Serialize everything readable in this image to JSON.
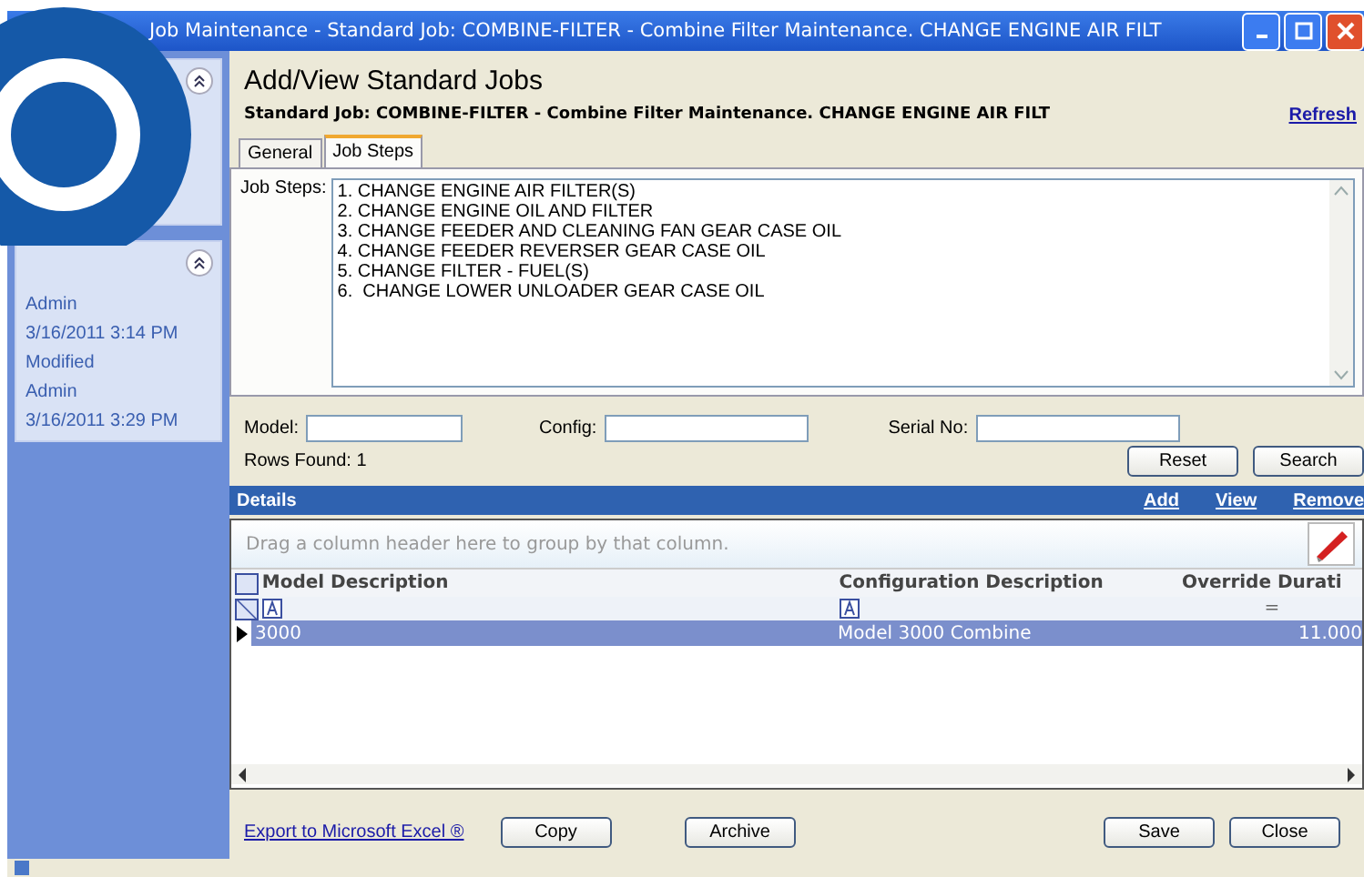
{
  "window": {
    "title": "Job Maintenance - Standard Job: COMBINE-FILTER - Combine Filter Maintenance. CHANGE ENGINE AIR FILT"
  },
  "sidebar": {
    "items": [
      {
        "text": "Admin"
      },
      {
        "text": "3/16/2011 3:14 PM"
      },
      {
        "text": "Modified"
      },
      {
        "text": "Admin"
      },
      {
        "text": "3/16/2011 3:29 PM"
      }
    ]
  },
  "header": {
    "title": "Add/View Standard Jobs",
    "subtitle": "Standard Job: COMBINE-FILTER - Combine Filter Maintenance. CHANGE ENGINE AIR FILT",
    "refresh": "Refresh"
  },
  "tabs": [
    {
      "label": "General",
      "selected": false
    },
    {
      "label": "Job Steps",
      "selected": true
    }
  ],
  "job_steps": {
    "label": "Job Steps:",
    "lines": [
      "1. CHANGE ENGINE AIR FILTER(S)",
      "2. CHANGE ENGINE OIL AND FILTER",
      "3. CHANGE FEEDER AND CLEANING FAN GEAR CASE OIL",
      "4. CHANGE FEEDER REVERSER GEAR CASE OIL",
      "5. CHANGE FILTER - FUEL(S)",
      "6.  CHANGE LOWER UNLOADER GEAR CASE OIL"
    ]
  },
  "filters": [
    {
      "label": "Model:"
    },
    {
      "label": "Config:"
    },
    {
      "label": "Serial No:"
    }
  ],
  "rows_found": "Rows Found: 1",
  "filter_buttons": [
    "Reset",
    "Search"
  ],
  "details": {
    "title": "Details",
    "links": [
      "Add",
      "View",
      "Remove"
    ]
  },
  "group_hint": "Drag a column header here to group by that column.",
  "table": {
    "columns": [
      "Model Description",
      "Configuration Description",
      "Override Durati"
    ],
    "filter_row": [
      {
        "kind": "text"
      },
      {
        "kind": "text"
      },
      {
        "kind": "equals",
        "text": "="
      }
    ],
    "rows": [
      {
        "cells": [
          "3000",
          "Model 3000 Combine",
          "11.000"
        ],
        "selected": true
      }
    ]
  },
  "footer": {
    "export_link": "Export to Microsoft Excel ®",
    "left_buttons": [
      "Copy",
      "Archive"
    ],
    "right_buttons": [
      "Save",
      "Close"
    ]
  }
}
